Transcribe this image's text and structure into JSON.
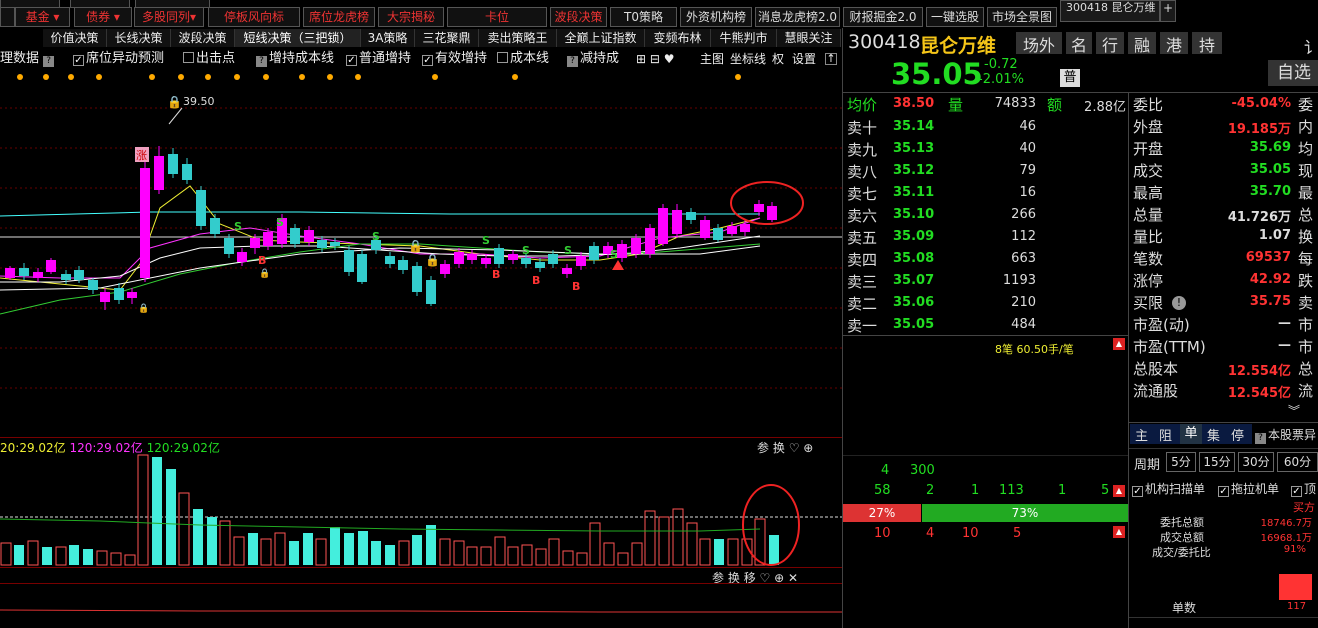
{
  "topbar": {
    "row1": [
      "基金",
      "债券",
      "多股同列",
      "停板风向标",
      "席位龙虎榜",
      "大宗揭秘",
      "卡位",
      "波段决策",
      "T0策略",
      "外资机构榜",
      "消息龙虎榜2.0",
      "财报掘金2.0",
      "一键选股",
      "市场全景图"
    ],
    "title_tab": "300418 昆仑万维",
    "plus": "+"
  },
  "strategy_tabs": [
    "价值决策",
    "长线决策",
    "波段决策",
    "短线决策（三把锁）",
    "3A策略",
    "三花聚鼎",
    "卖出策略王",
    "全巅上证指数",
    "变频布林",
    "牛熊判市",
    "慧眼关注"
  ],
  "options": {
    "items": [
      "理数据",
      "席位异动预测",
      "出击点",
      "增持成本线",
      "普通增持",
      "有效增持",
      "成本线",
      "减持成"
    ],
    "main_fig": "主图",
    "coord": "坐标线",
    "right": "权",
    "settings": "设置"
  },
  "chart": {
    "peak_label": "39.50",
    "limit_up_mark": "涨",
    "s_marks": [
      "S",
      "S",
      "S",
      "S",
      "S",
      "S",
      "S"
    ],
    "b_marks": [
      "B",
      "B",
      "B",
      "B",
      "B"
    ]
  },
  "vol_panel": {
    "legend": [
      "20:29.02亿",
      "120:29.02亿",
      "120:29.02亿"
    ],
    "buttons": [
      "参",
      "换"
    ],
    "sub_buttons": [
      "参",
      "换",
      "移"
    ]
  },
  "quote": {
    "code": "300418",
    "name": "昆仑万维",
    "tags": [
      "场外",
      "名",
      "行",
      "融",
      "港",
      "持"
    ],
    "edge_char": "讠",
    "price": "35.05",
    "change": "-0.72",
    "pct": "-2.01%",
    "badge": "普",
    "select_btn": "自选"
  },
  "avg_row": {
    "avg_label": "均价",
    "avg": "38.50",
    "vol_label": "量",
    "vol": "74833",
    "amt_label": "额",
    "amt": "2.88亿"
  },
  "orderbook": [
    {
      "label": "卖十",
      "price": "35.14",
      "vol": "46"
    },
    {
      "label": "卖九",
      "price": "35.13",
      "vol": "40"
    },
    {
      "label": "卖八",
      "price": "35.12",
      "vol": "79"
    },
    {
      "label": "卖七",
      "price": "35.11",
      "vol": "16"
    },
    {
      "label": "卖六",
      "price": "35.10",
      "vol": "266"
    },
    {
      "label": "卖五",
      "price": "35.09",
      "vol": "112"
    },
    {
      "label": "卖四",
      "price": "35.08",
      "vol": "663"
    },
    {
      "label": "卖三",
      "price": "35.07",
      "vol": "1193"
    },
    {
      "label": "卖二",
      "price": "35.06",
      "vol": "210"
    },
    {
      "label": "卖一",
      "price": "35.05",
      "vol": "484"
    }
  ],
  "tick_info": "8笔 60.50手/笔",
  "stats": [
    {
      "label": "委比",
      "value": "-45.04%",
      "color": "#f33",
      "l2": "委"
    },
    {
      "label": "外盘",
      "value": "19.185万",
      "color": "#f33",
      "l2": "内"
    },
    {
      "label": "开盘",
      "value": "35.69",
      "color": "#2d2",
      "l2": "均"
    },
    {
      "label": "成交",
      "value": "35.05",
      "color": "#2d2",
      "l2": "现"
    },
    {
      "label": "最高",
      "value": "35.70",
      "color": "#2d2",
      "l2": "最"
    },
    {
      "label": "总量",
      "value": "41.726万",
      "color": "#ddd",
      "l2": "总"
    },
    {
      "label": "量比",
      "value": "1.07",
      "color": "#ddd",
      "l2": "换"
    },
    {
      "label": "笔数",
      "value": "69537",
      "color": "#f33",
      "l2": "每"
    },
    {
      "label": "涨停",
      "value": "42.92",
      "color": "#f33",
      "l2": "跌"
    },
    {
      "label": "买限",
      "value": "35.75",
      "color": "#f33",
      "l2": "卖"
    },
    {
      "label": "市盈(动)",
      "value": "—",
      "color": "#ddd",
      "l2": "市"
    },
    {
      "label": "市盈(TTM)",
      "value": "—",
      "color": "#ddd",
      "l2": "市"
    },
    {
      "label": "总股本",
      "value": "12.554亿",
      "color": "#f33",
      "l2": "总"
    },
    {
      "label": "流通股",
      "value": "12.545亿",
      "color": "#f33",
      "l2": "流"
    }
  ],
  "flow": {
    "row1": [
      "4",
      "300"
    ],
    "row2": [
      "58",
      "2",
      "1",
      "113",
      "1",
      "5"
    ],
    "bar_left": "27%",
    "bar_right": "73%",
    "row3": [
      "10",
      "4",
      "10",
      "5"
    ]
  },
  "right_tabs": [
    "主",
    "阻",
    "单",
    "集",
    "停"
  ],
  "this_stock": "本股票异",
  "periods": [
    "周期",
    "5分",
    "15分",
    "30分",
    "60分"
  ],
  "scan_opts": [
    "机构扫描单",
    "拖拉机单",
    "顶"
  ],
  "order_stats": {
    "buyer": "买方",
    "rows": [
      {
        "label": "委托总额",
        "value": "18746.7万"
      },
      {
        "label": "成交总额",
        "value": "16968.1万"
      },
      {
        "label": "成交/委托比",
        "value": "91%"
      }
    ],
    "count_label": "单数",
    "count": "117"
  },
  "colors": {
    "up": "#ff00ff",
    "down": "#3cc",
    "accent_red": "#f33",
    "accent_green": "#2d2"
  }
}
